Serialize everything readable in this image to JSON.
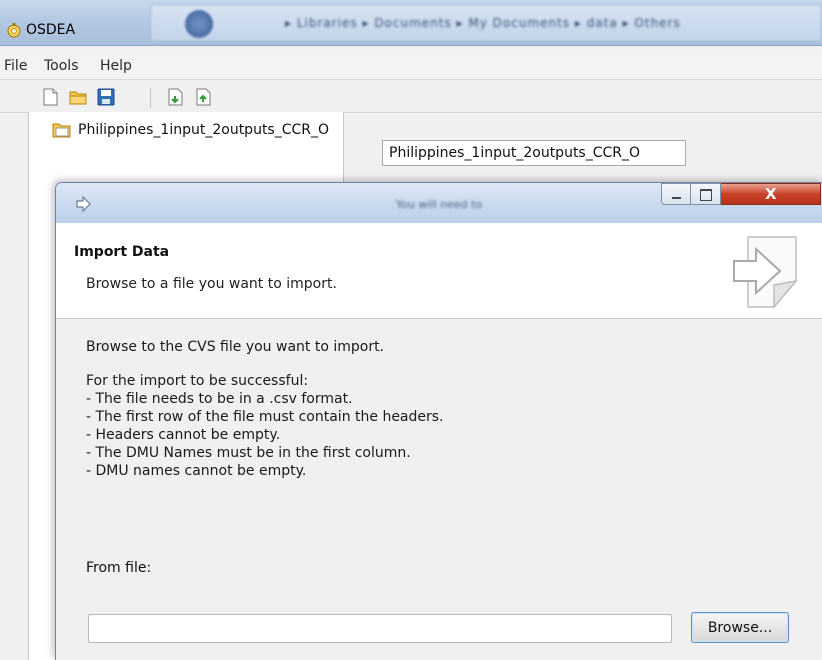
{
  "window": {
    "title": "OSDEA",
    "background_breadcrumb": "▸ Libraries ▸ Documents ▸ My Documents ▸ data ▸ Others"
  },
  "menu": [
    "File",
    "Tools",
    "Help"
  ],
  "toolbar": {
    "icons": [
      "new-file-icon",
      "open-folder-icon",
      "save-icon",
      "import-icon",
      "export-icon"
    ]
  },
  "tree": {
    "item_label": "Philippines_1input_2outputs_CCR_O"
  },
  "model": {
    "name_value": "Philippines_1input_2outputs_CCR_O"
  },
  "dialog": {
    "background_title": "You will need to",
    "header_title": "Import Data",
    "header_description": "Browse to a file you want to import.",
    "intro": "Browse to the CVS file you want to import.",
    "rules_heading": "For the import to be successful:",
    "rules": [
      "- The file needs to be in a .csv format.",
      "- The first row of the file must contain the headers.",
      "- Headers cannot be empty.",
      "- The DMU Names must be in the first column.",
      "- DMU names cannot be empty."
    ],
    "from_file_label": "From file:",
    "file_path_value": "",
    "browse_label": "Browse...",
    "close_glyph": "X"
  }
}
